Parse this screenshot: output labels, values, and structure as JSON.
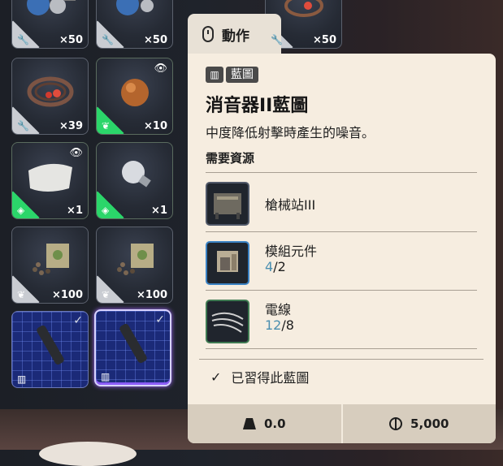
{
  "inventory": {
    "row0": [
      {
        "qty": "×50",
        "icon": "wrench-icon"
      },
      {
        "qty": "×50",
        "icon": "wrench-icon"
      },
      {
        "qty": "×50",
        "icon": "wrench-icon"
      }
    ],
    "row1": [
      {
        "qty": "×39",
        "icon": "wrench-icon"
      },
      {
        "qty": "×10",
        "icon": "leaf-icon"
      }
    ],
    "row2": [
      {
        "qty": "×1",
        "icon": "diamond-icon"
      },
      {
        "qty": "×1",
        "icon": "diamond-icon"
      }
    ],
    "row3": [
      {
        "qty": "×100",
        "icon": "leaf-icon"
      },
      {
        "qty": "×100",
        "icon": "leaf-icon"
      }
    ],
    "row4": [
      {
        "icon": "blueprint-book-icon"
      },
      {
        "icon": "blueprint-book-icon"
      }
    ]
  },
  "tooltip": {
    "tab_label": "動作",
    "tag_label": "藍圖",
    "title": "消音器II藍圖",
    "description": "中度降低射擊時產生的噪音。",
    "requirements_title": "需要資源",
    "requirements": [
      {
        "name": "槍械站III",
        "have": "",
        "sep": "",
        "need": ""
      },
      {
        "name": "模組元件",
        "have": "4",
        "sep": "/",
        "need": "2"
      },
      {
        "name": "電線",
        "have": "12",
        "sep": "/",
        "need": "8"
      }
    ],
    "learned_text": "已習得此藍圖",
    "weight": "0.0",
    "price": "5,000"
  },
  "colors": {
    "panel_bg": "#f6ede0",
    "rarity_green": "#2bd66a",
    "have_count": "#4b8fb0",
    "blueprint_blue": "#1b2a78"
  }
}
